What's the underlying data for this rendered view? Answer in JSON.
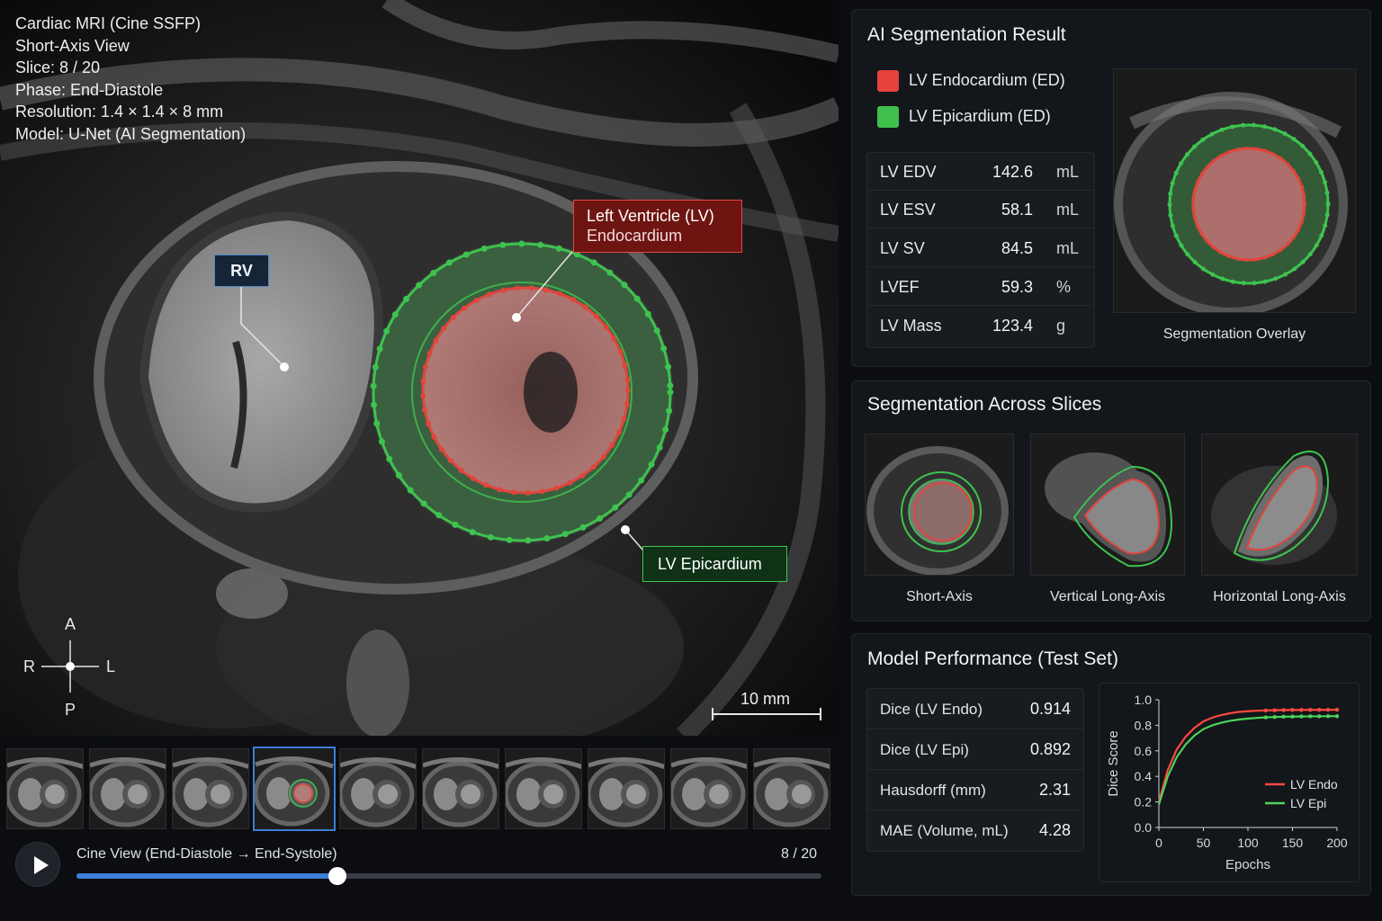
{
  "viewer": {
    "info": [
      "Cardiac MRI (Cine SSFP)",
      "Short-Axis View",
      "Slice: 8 / 20",
      "Phase: End-Diastole",
      "Resolution: 1.4 × 1.4 × 8 mm",
      "Model: U-Net (AI Segmentation)"
    ],
    "labels": {
      "rv": "RV",
      "lv_title": "Left Ventricle (LV)",
      "lv_sub": "Endocardium",
      "epi": "LV Epicardium"
    },
    "orientation": {
      "anterior": "A",
      "posterior": "P",
      "right": "R",
      "left": "L"
    },
    "scale_bar": "10 mm",
    "colors": {
      "endo": "#e0453c",
      "epi": "#3ec34f",
      "accent": "#3c7fd6"
    }
  },
  "thumbnails": {
    "count": 10,
    "selected_index": 3
  },
  "cine": {
    "label": "Cine View (End-Diastole → End-Systole)",
    "counter": "8 / 20",
    "progress": 0.35
  },
  "seg_result": {
    "title": "AI Segmentation Result",
    "legend": [
      {
        "label": "LV Endocardium (ED)",
        "color": "#e5433b"
      },
      {
        "label": "LV Epicardium (ED)",
        "color": "#3fbf4c"
      }
    ],
    "metrics": [
      {
        "name": "LV EDV",
        "value": "142.6",
        "unit": "mL"
      },
      {
        "name": "LV ESV",
        "value": "58.1",
        "unit": "mL"
      },
      {
        "name": "LV SV",
        "value": "84.5",
        "unit": "mL"
      },
      {
        "name": "LVEF",
        "value": "59.3",
        "unit": "%"
      },
      {
        "name": "LV Mass",
        "value": "123.4",
        "unit": "g"
      }
    ],
    "overlay_caption": "Segmentation Overlay"
  },
  "slices": {
    "title": "Segmentation Across Slices",
    "items": [
      {
        "caption": "Short-Axis"
      },
      {
        "caption": "Vertical Long-Axis"
      },
      {
        "caption": "Horizontal Long-Axis"
      }
    ]
  },
  "performance": {
    "title": "Model Performance (Test Set)",
    "rows": [
      {
        "name": "Dice (LV Endo)",
        "value": "0.914"
      },
      {
        "name": "Dice (LV Epi)",
        "value": "0.892"
      },
      {
        "name": "Hausdorff (mm)",
        "value": "2.31"
      },
      {
        "name": "MAE (Volume, mL)",
        "value": "4.28"
      }
    ]
  },
  "chart_data": {
    "type": "line",
    "xlabel": "Epochs",
    "ylabel": "Dice Score",
    "xlim": [
      0,
      200
    ],
    "ylim": [
      0,
      1.0
    ],
    "xticks": [
      "0",
      "50",
      "100",
      "150",
      "200"
    ],
    "yticks": [
      "0.0",
      "0.2",
      "0.4",
      "0.6",
      "0.8",
      "1.0"
    ],
    "legend_position": "bottom-right",
    "x": [
      0,
      10,
      20,
      30,
      40,
      50,
      60,
      70,
      80,
      90,
      100,
      110,
      120,
      130,
      140,
      150,
      160,
      170,
      180,
      190,
      200
    ],
    "series": [
      {
        "name": "LV Endo",
        "color": "#ff4a40",
        "values": [
          0.2,
          0.45,
          0.61,
          0.71,
          0.78,
          0.83,
          0.86,
          0.88,
          0.895,
          0.905,
          0.91,
          0.914,
          0.916,
          0.918,
          0.919,
          0.92,
          0.92,
          0.921,
          0.921,
          0.921,
          0.922
        ]
      },
      {
        "name": "LV Epi",
        "color": "#4cd35a",
        "values": [
          0.18,
          0.4,
          0.55,
          0.65,
          0.72,
          0.77,
          0.8,
          0.82,
          0.835,
          0.845,
          0.852,
          0.858,
          0.862,
          0.865,
          0.867,
          0.868,
          0.869,
          0.87,
          0.87,
          0.871,
          0.871
        ]
      }
    ]
  }
}
